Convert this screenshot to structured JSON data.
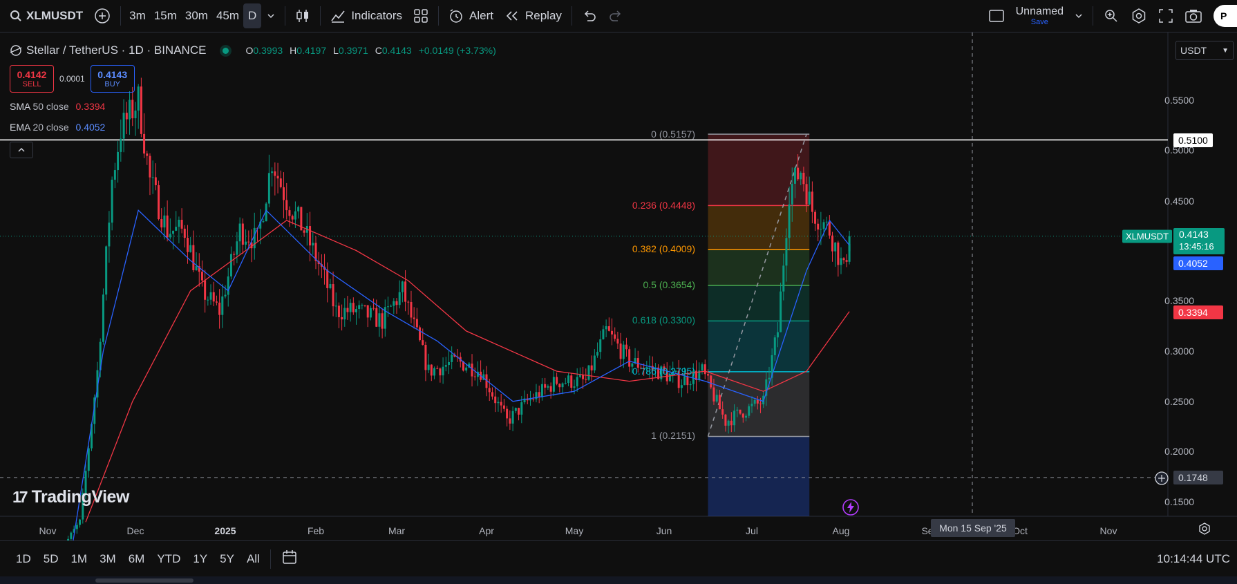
{
  "toolbar": {
    "symbol": "XLMUSDT",
    "intervals": [
      "3m",
      "15m",
      "30m",
      "45m",
      "D"
    ],
    "active_interval": "D",
    "indicators_label": "Indicators",
    "alert_label": "Alert",
    "replay_label": "Replay",
    "layout_name": "Unnamed",
    "save_label": "Save",
    "publish_label": "P"
  },
  "legend": {
    "title": "Stellar / TetherUS · 1D · BINANCE",
    "ohlc": {
      "o_key": "O",
      "o": "0.3993",
      "h_key": "H",
      "h": "0.4197",
      "l_key": "L",
      "l": "0.3971",
      "c_key": "C",
      "c": "0.4143",
      "change": "+0.0149 (+3.73%)"
    }
  },
  "trade": {
    "sell_price": "0.4142",
    "sell_label": "SELL",
    "spread": "0.0001",
    "buy_price": "0.4143",
    "buy_label": "BUY"
  },
  "indicators": [
    {
      "name": "SMA",
      "params": "50 close",
      "value": "0.3394",
      "color": "#f23645"
    },
    {
      "name": "EMA",
      "params": "20 close",
      "value": "0.4052",
      "color": "#2962ff"
    }
  ],
  "price_scale": {
    "currency": "USDT",
    "ticks": [
      "0.5500",
      "0.5000",
      "0.4500",
      "0.3500",
      "0.3000",
      "0.2500",
      "0.2000",
      "0.1500"
    ],
    "horizontal_line_value": "0.5100",
    "last_price_symbol": "XLMUSDT",
    "last_price": "0.4143",
    "countdown": "13:45:16",
    "ema_value": "0.4052",
    "sma_value": "0.3394",
    "crosshair_price": "0.1748"
  },
  "time_axis": {
    "labels": [
      "Nov",
      "Dec",
      "2025",
      "Feb",
      "Mar",
      "Apr",
      "May",
      "Jun",
      "Jul",
      "Aug",
      "Se",
      "Oct",
      "Nov"
    ],
    "crosshair_date": "Mon 15 Sep '25"
  },
  "fib": {
    "levels": [
      {
        "label": "0 (0.5157)",
        "color": "#9598a1"
      },
      {
        "label": "0.236 (0.4448)",
        "color": "#f23645"
      },
      {
        "label": "0.382 (0.4009)",
        "color": "#ff9800"
      },
      {
        "label": "0.5 (0.3654)",
        "color": "#4caf50"
      },
      {
        "label": "0.618 (0.3300)",
        "color": "#089981"
      },
      {
        "label": "0.786 (0.2795)",
        "color": "#00bcd4"
      },
      {
        "label": "1 (0.2151)",
        "color": "#9598a1"
      }
    ]
  },
  "chart_data": {
    "type": "candlestick",
    "symbol": "XLMUSDT",
    "interval": "1D",
    "y_range": [
      0.13,
      0.58
    ],
    "x_range": [
      "2024-10-25",
      "2025-11-30"
    ],
    "horizontal_line": 0.51,
    "last_close": 0.4143,
    "close_path": [
      [
        "2024-11-05",
        0.1
      ],
      [
        "2024-11-12",
        0.13
      ],
      [
        "2024-11-18",
        0.28
      ],
      [
        "2024-11-23",
        0.47
      ],
      [
        "2024-11-26",
        0.52
      ],
      [
        "2024-12-02",
        0.55
      ],
      [
        "2024-12-06",
        0.47
      ],
      [
        "2024-12-12",
        0.42
      ],
      [
        "2024-12-18",
        0.42
      ],
      [
        "2024-12-24",
        0.36
      ],
      [
        "2024-12-30",
        0.34
      ],
      [
        "2025-01-06",
        0.42
      ],
      [
        "2025-01-12",
        0.41
      ],
      [
        "2025-01-17",
        0.49
      ],
      [
        "2025-01-22",
        0.45
      ],
      [
        "2025-01-28",
        0.42
      ],
      [
        "2025-02-03",
        0.38
      ],
      [
        "2025-02-08",
        0.34
      ],
      [
        "2025-02-15",
        0.34
      ],
      [
        "2025-02-24",
        0.33
      ],
      [
        "2025-03-03",
        0.36
      ],
      [
        "2025-03-12",
        0.28
      ],
      [
        "2025-03-22",
        0.29
      ],
      [
        "2025-03-30",
        0.28
      ],
      [
        "2025-04-08",
        0.23
      ],
      [
        "2025-04-15",
        0.25
      ],
      [
        "2025-04-25",
        0.27
      ],
      [
        "2025-05-05",
        0.27
      ],
      [
        "2025-05-12",
        0.32
      ],
      [
        "2025-05-20",
        0.29
      ],
      [
        "2025-05-30",
        0.28
      ],
      [
        "2025-06-07",
        0.27
      ],
      [
        "2025-06-14",
        0.28
      ],
      [
        "2025-06-22",
        0.23
      ],
      [
        "2025-06-28",
        0.24
      ],
      [
        "2025-07-05",
        0.25
      ],
      [
        "2025-07-10",
        0.32
      ],
      [
        "2025-07-14",
        0.46
      ],
      [
        "2025-07-18",
        0.48
      ],
      [
        "2025-07-22",
        0.44
      ],
      [
        "2025-07-28",
        0.42
      ],
      [
        "2025-08-02",
        0.38
      ],
      [
        "2025-08-04",
        0.4143
      ]
    ],
    "sma50_path": [
      [
        "2024-11-14",
        0.13
      ],
      [
        "2024-11-30",
        0.25
      ],
      [
        "2024-12-20",
        0.36
      ],
      [
        "2025-01-08",
        0.4
      ],
      [
        "2025-01-22",
        0.43
      ],
      [
        "2025-02-15",
        0.4
      ],
      [
        "2025-03-05",
        0.37
      ],
      [
        "2025-03-25",
        0.32
      ],
      [
        "2025-04-25",
        0.28
      ],
      [
        "2025-05-20",
        0.27
      ],
      [
        "2025-06-15",
        0.28
      ],
      [
        "2025-07-05",
        0.26
      ],
      [
        "2025-07-20",
        0.28
      ],
      [
        "2025-08-04",
        0.3394
      ]
    ],
    "ema20_path": [
      [
        "2024-11-08",
        0.08
      ],
      [
        "2024-11-20",
        0.3
      ],
      [
        "2024-12-02",
        0.44
      ],
      [
        "2024-12-20",
        0.39
      ],
      [
        "2025-01-02",
        0.36
      ],
      [
        "2025-01-15",
        0.44
      ],
      [
        "2025-02-05",
        0.38
      ],
      [
        "2025-02-25",
        0.34
      ],
      [
        "2025-03-15",
        0.31
      ],
      [
        "2025-04-10",
        0.25
      ],
      [
        "2025-05-01",
        0.26
      ],
      [
        "2025-05-20",
        0.29
      ],
      [
        "2025-06-15",
        0.27
      ],
      [
        "2025-07-05",
        0.25
      ],
      [
        "2025-07-20",
        0.38
      ],
      [
        "2025-07-28",
        0.43
      ],
      [
        "2025-08-04",
        0.4052
      ]
    ],
    "fib_retracement": {
      "start_date": "2025-06-16",
      "end_date": "2025-07-21",
      "levels": [
        {
          "ratio": 0,
          "price": 0.5157
        },
        {
          "ratio": 0.236,
          "price": 0.4448
        },
        {
          "ratio": 0.382,
          "price": 0.4009
        },
        {
          "ratio": 0.5,
          "price": 0.3654
        },
        {
          "ratio": 0.618,
          "price": 0.33
        },
        {
          "ratio": 0.786,
          "price": 0.2795
        },
        {
          "ratio": 1,
          "price": 0.2151
        }
      ]
    }
  },
  "bottombar": {
    "ranges": [
      "1D",
      "5D",
      "1M",
      "3M",
      "6M",
      "YTD",
      "1Y",
      "5Y",
      "All"
    ],
    "clock": "10:14:44 UTC"
  }
}
